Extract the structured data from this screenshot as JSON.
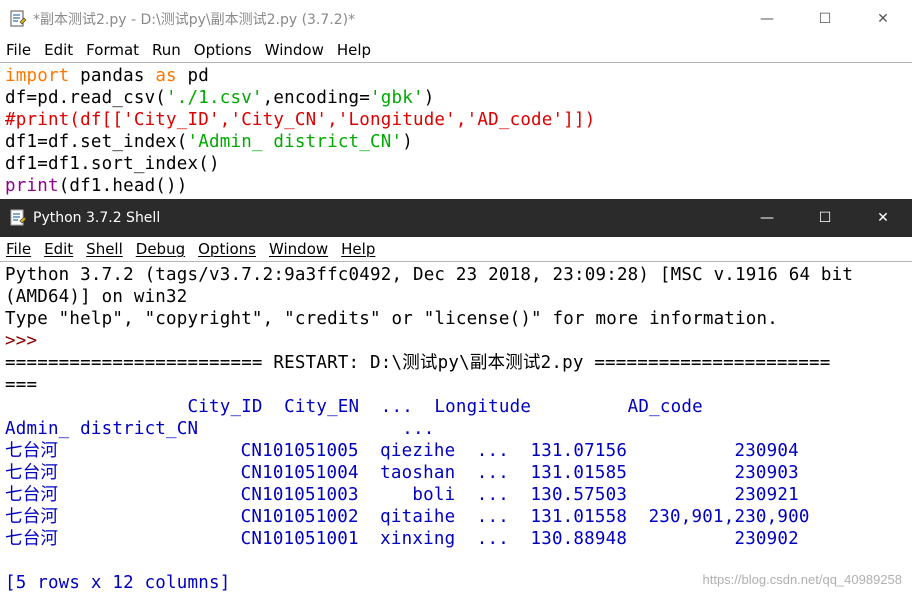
{
  "editor": {
    "title": "*副本测试2.py - D:\\测试py\\副本测试2.py (3.7.2)*",
    "menu": [
      "File",
      "Edit",
      "Format",
      "Run",
      "Options",
      "Window",
      "Help"
    ],
    "lines": [
      [
        {
          "t": "import",
          "c": "kw"
        },
        {
          "t": " pandas ",
          "c": "blk"
        },
        {
          "t": "as",
          "c": "kw"
        },
        {
          "t": " pd",
          "c": "blk"
        }
      ],
      [
        {
          "t": "df=pd.read_csv(",
          "c": "blk"
        },
        {
          "t": "'./1.csv'",
          "c": "str"
        },
        {
          "t": ",encoding=",
          "c": "blk"
        },
        {
          "t": "'gbk'",
          "c": "str"
        },
        {
          "t": ")",
          "c": "blk"
        }
      ],
      [
        {
          "t": "#print(df[['City_ID','City_CN','Longitude','AD_code']])",
          "c": "cmt"
        }
      ],
      [
        {
          "t": "df1=df.set_index(",
          "c": "blk"
        },
        {
          "t": "'Admin_ district_CN'",
          "c": "str"
        },
        {
          "t": ")",
          "c": "blk"
        }
      ],
      [
        {
          "t": "df1=df1.sort_index()",
          "c": "blk"
        }
      ],
      [
        {
          "t": "print",
          "c": "bi"
        },
        {
          "t": "(df1.head())",
          "c": "blk"
        }
      ]
    ]
  },
  "shell": {
    "title": "Python 3.7.2 Shell",
    "menu": [
      "File",
      "Edit",
      "Shell",
      "Debug",
      "Options",
      "Window",
      "Help"
    ],
    "lines": [
      [
        {
          "t": "Python 3.7.2 (tags/v3.7.2:9a3ffc0492, Dec 23 2018, 23:09:28) [MSC v.1916 64 bit",
          "c": "blk"
        }
      ],
      [
        {
          "t": "(AMD64)] on win32",
          "c": "blk"
        }
      ],
      [
        {
          "t": "Type \"help\", \"copyright\", \"credits\" or \"license()\" for more information.",
          "c": "blk"
        }
      ],
      [
        {
          "t": ">>> ",
          "c": "prompt"
        }
      ],
      [
        {
          "t": "======================== RESTART: D:\\测试py\\副本测试2.py ======================",
          "c": "restart"
        }
      ],
      [
        {
          "t": "===",
          "c": "restart"
        }
      ],
      [
        {
          "t": "                 City_ID  City_EN  ...  Longitude         AD_code",
          "c": "out"
        }
      ],
      [
        {
          "t": "Admin_ district_CN                   ...",
          "c": "out"
        }
      ],
      [
        {
          "t": "七台河                 CN101051005  qiezihe  ...  131.07156          230904",
          "c": "out"
        }
      ],
      [
        {
          "t": "七台河                 CN101051004  taoshan  ...  131.01585          230903",
          "c": "out"
        }
      ],
      [
        {
          "t": "七台河                 CN101051003     boli  ...  130.57503          230921",
          "c": "out"
        }
      ],
      [
        {
          "t": "七台河                 CN101051002  qitaihe  ...  131.01558  230,901,230,900",
          "c": "out"
        }
      ],
      [
        {
          "t": "七台河                 CN101051001  xinxing  ...  130.88948          230902",
          "c": "out"
        }
      ],
      [
        {
          "t": "",
          "c": "out"
        }
      ],
      [
        {
          "t": "[5 rows x 12 columns]",
          "c": "out"
        }
      ]
    ]
  },
  "window_controls": {
    "minimize": "—",
    "maximize": "☐",
    "close": "✕"
  },
  "watermark": "https://blog.csdn.net/qq_40989258"
}
